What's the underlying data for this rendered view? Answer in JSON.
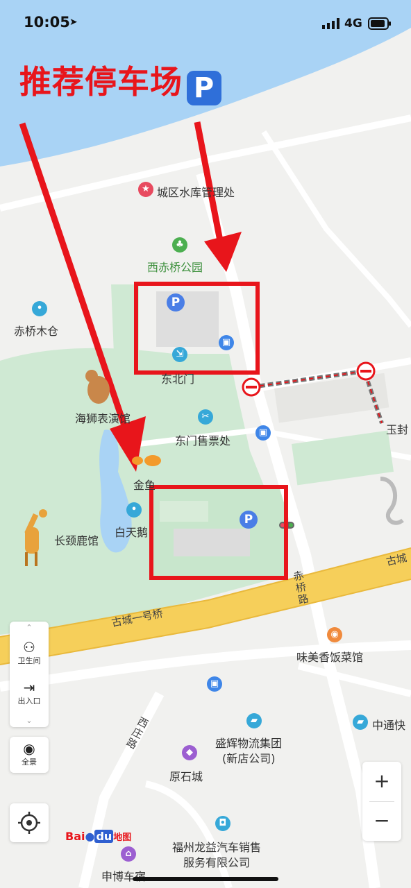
{
  "status_bar": {
    "time": "10:05",
    "network": "4G"
  },
  "headline": "推荐停车场",
  "poi": {
    "management_office": "城区水库管理处",
    "west_bridge_park": "西赤桥公园",
    "chiqiao_mucang": "赤桥木仓",
    "east_north_gate": "东北门",
    "sea_lion_hall": "海狮表演馆",
    "east_ticket_office": "东门售票处",
    "goldfish": "金鱼",
    "white_swan": "白天鹅",
    "giraffe_hall": "长颈鹿馆",
    "weimeixiang": "味美香饭菜馆",
    "zhongtong": "中通快",
    "shenghui_line1": "盛辉物流集团",
    "shenghui_line2": "(新店公司)",
    "yuanshi": "原石城",
    "longyi_line1": "福州龙益汽车销售",
    "longyi_line2": "服务有限公司",
    "shenbo": "申博车宿",
    "yufeng": "玉封"
  },
  "roads": {
    "gucheng_bridge": "古城一号桥",
    "gucheng_right": "古城",
    "chiqiao_road": "赤桥路",
    "xizhuang_road": "西庄路"
  },
  "controls": {
    "restroom": "卫生间",
    "entrance_exit": "出入口",
    "panorama": "全景",
    "zoom_in": "+",
    "zoom_out": "−"
  },
  "logo": {
    "bai": "Bai",
    "du": "du",
    "map": "地图"
  },
  "colors": {
    "annotation_red": "#e8151b",
    "water": "#a9d3f5",
    "park": "#cfe9d3",
    "road_yellow": "#f6cf5a",
    "parking_blue": "#4a7ee6"
  },
  "icons": [
    "signal-icon",
    "location-arrow-icon",
    "battery-icon",
    "parking-icon",
    "bus-icon",
    "tickets-icon",
    "restroom-icon",
    "exit-icon",
    "panorama-icon",
    "locate-icon",
    "no-entry-icon"
  ]
}
